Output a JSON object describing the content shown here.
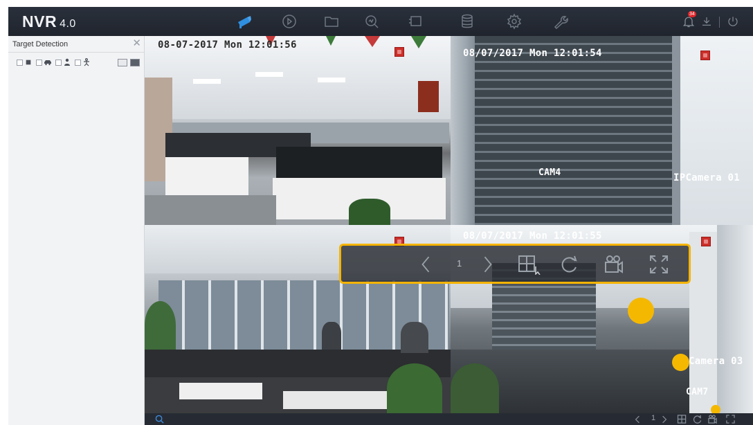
{
  "app": {
    "logo": "NVR",
    "version": "4.0"
  },
  "topbar": {
    "nav": [
      {
        "name": "live-view",
        "icon": "camera-icon",
        "active": true
      },
      {
        "name": "playback",
        "icon": "playback-icon"
      },
      {
        "name": "file-management",
        "icon": "folder-icon"
      },
      {
        "name": "smart-analysis",
        "icon": "search-chart-icon"
      },
      {
        "name": "configuration-window",
        "icon": "window-icon"
      },
      {
        "name": "storage",
        "icon": "database-icon"
      },
      {
        "name": "system",
        "icon": "gear-icon"
      },
      {
        "name": "maintenance",
        "icon": "wrench-icon"
      }
    ],
    "alarm_count": "34",
    "accent": "#2f8fe0"
  },
  "side_panel": {
    "title": "Target Detection",
    "filters": [
      {
        "name": "all",
        "checked": true
      },
      {
        "name": "vehicle",
        "icon": "car-icon",
        "checked": false
      },
      {
        "name": "human",
        "icon": "person-icon",
        "checked": false
      },
      {
        "name": "perimeter",
        "icon": "human-body-icon",
        "checked": false
      }
    ]
  },
  "cameras": [
    {
      "id": "cam1",
      "timestamp": "08-07-2017 Mon 12:01:56",
      "label": "",
      "name": ""
    },
    {
      "id": "cam2",
      "timestamp": "08/07/2017 Mon 12:01:54",
      "label": "CAM4",
      "name": "IPCamera 01"
    },
    {
      "id": "cam3",
      "timestamp": "",
      "label": "",
      "name": ""
    },
    {
      "id": "cam4",
      "timestamp": "08/07/2017 Mon 12:01:55",
      "label": "CAM7",
      "name": "Camera 03"
    }
  ],
  "floating_toolbar": {
    "page": "1",
    "buttons": [
      "previous-screen",
      "next-screen",
      "layout",
      "start-auto-switch",
      "start-recording",
      "full-screen"
    ],
    "highlight_color": "#f5b400"
  },
  "bottom_bar": {
    "page": "1"
  }
}
